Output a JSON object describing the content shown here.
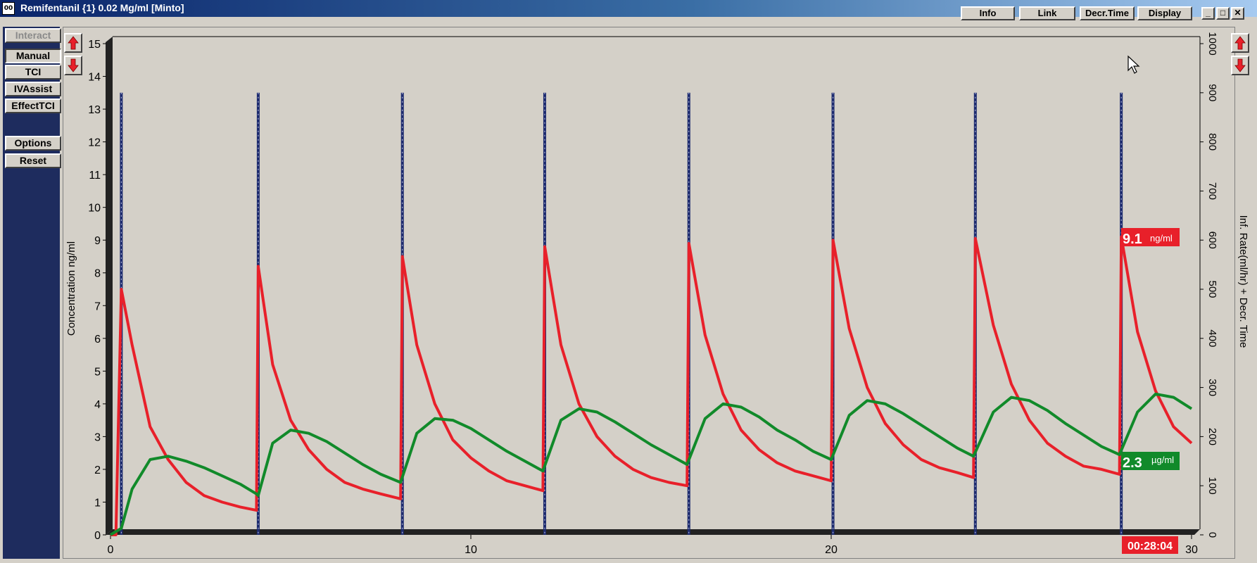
{
  "window": {
    "icon_text": "00",
    "title": "Remifentanil {1} 0.02 Mg/ml [Minto]",
    "buttons": [
      "Info",
      "Link",
      "Decr.Time",
      "Display"
    ],
    "controls": [
      "_",
      "□",
      "✕"
    ]
  },
  "sidebar": {
    "mode_buttons": [
      {
        "label": "Interact",
        "state": "disabled"
      },
      {
        "label": "Manual",
        "state": "pressed"
      },
      {
        "label": "TCI",
        "state": "normal"
      },
      {
        "label": "IVAssist",
        "state": "normal"
      },
      {
        "label": "EffectTCI",
        "state": "normal"
      }
    ],
    "action_buttons": [
      "Options",
      "Reset"
    ]
  },
  "readouts": {
    "plasma_value": "9.1",
    "plasma_unit": "ng/ml",
    "effect_value": "2.3",
    "effect_unit": "µg/ml",
    "elapsed_time": "00:28:04"
  },
  "colors": {
    "plasma": "#e8202a",
    "effect": "#118a2a",
    "bolus": "#1c2a6e",
    "plot_background": "#d4d0c8",
    "sidebar_background": "#1e2c5e"
  },
  "chart_data": {
    "type": "line",
    "xlim": [
      0,
      30
    ],
    "x_ticks": [
      0,
      10,
      20,
      30
    ],
    "ylim": [
      0,
      15
    ],
    "y_ticks": [
      0,
      1,
      2,
      3,
      4,
      5,
      6,
      7,
      8,
      9,
      10,
      11,
      12,
      13,
      14,
      15
    ],
    "ylabel": "Concentration ng/ml",
    "y2lim": [
      0,
      1000
    ],
    "y2_ticks": [
      0,
      100,
      200,
      300,
      400,
      500,
      600,
      700,
      800,
      900,
      1000
    ],
    "y2label": "Inf. Rate(ml/hr) + Decr. Time",
    "bolus_times": [
      0.3,
      4.1,
      8.1,
      12.05,
      16.05,
      20.05,
      24.0,
      28.05
    ],
    "bolus_rate": 900,
    "series": [
      {
        "key": "plasma",
        "points": [
          [
            0,
            0
          ],
          [
            0.15,
            0
          ],
          [
            0.3,
            7.5
          ],
          [
            0.6,
            5.8
          ],
          [
            1.1,
            3.3
          ],
          [
            1.6,
            2.3
          ],
          [
            2.1,
            1.6
          ],
          [
            2.6,
            1.2
          ],
          [
            3.1,
            1.0
          ],
          [
            3.6,
            0.85
          ],
          [
            4.05,
            0.75
          ],
          [
            4.1,
            8.2
          ],
          [
            4.5,
            5.2
          ],
          [
            5.0,
            3.5
          ],
          [
            5.5,
            2.6
          ],
          [
            6.0,
            2.0
          ],
          [
            6.5,
            1.6
          ],
          [
            7.0,
            1.4
          ],
          [
            7.5,
            1.25
          ],
          [
            8.05,
            1.1
          ],
          [
            8.1,
            8.5
          ],
          [
            8.5,
            5.8
          ],
          [
            9.0,
            4.0
          ],
          [
            9.5,
            2.9
          ],
          [
            10.0,
            2.35
          ],
          [
            10.5,
            1.95
          ],
          [
            11.0,
            1.65
          ],
          [
            11.5,
            1.5
          ],
          [
            12.0,
            1.35
          ],
          [
            12.05,
            8.8
          ],
          [
            12.5,
            5.8
          ],
          [
            13.0,
            4.0
          ],
          [
            13.5,
            3.0
          ],
          [
            14.0,
            2.4
          ],
          [
            14.5,
            2.0
          ],
          [
            15.0,
            1.75
          ],
          [
            15.5,
            1.6
          ],
          [
            16.0,
            1.5
          ],
          [
            16.05,
            8.9
          ],
          [
            16.5,
            6.1
          ],
          [
            17.0,
            4.3
          ],
          [
            17.5,
            3.2
          ],
          [
            18.0,
            2.6
          ],
          [
            18.5,
            2.2
          ],
          [
            19.0,
            1.95
          ],
          [
            19.5,
            1.8
          ],
          [
            20.0,
            1.65
          ],
          [
            20.05,
            9.0
          ],
          [
            20.5,
            6.3
          ],
          [
            21.0,
            4.5
          ],
          [
            21.5,
            3.4
          ],
          [
            22.0,
            2.75
          ],
          [
            22.5,
            2.3
          ],
          [
            23.0,
            2.05
          ],
          [
            23.5,
            1.9
          ],
          [
            23.95,
            1.75
          ],
          [
            24.0,
            9.05
          ],
          [
            24.5,
            6.4
          ],
          [
            25.0,
            4.6
          ],
          [
            25.5,
            3.5
          ],
          [
            26.0,
            2.8
          ],
          [
            26.5,
            2.4
          ],
          [
            27.0,
            2.1
          ],
          [
            27.5,
            2.0
          ],
          [
            28.0,
            1.85
          ],
          [
            28.05,
            9.1
          ],
          [
            28.5,
            6.2
          ],
          [
            29.0,
            4.4
          ],
          [
            29.5,
            3.3
          ],
          [
            30.0,
            2.8
          ]
        ]
      },
      {
        "key": "effect",
        "points": [
          [
            0,
            0
          ],
          [
            0.3,
            0.2
          ],
          [
            0.6,
            1.4
          ],
          [
            1.1,
            2.3
          ],
          [
            1.6,
            2.4
          ],
          [
            2.1,
            2.25
          ],
          [
            2.6,
            2.05
          ],
          [
            3.1,
            1.8
          ],
          [
            3.6,
            1.55
          ],
          [
            4.05,
            1.25
          ],
          [
            4.1,
            1.2
          ],
          [
            4.5,
            2.8
          ],
          [
            5.0,
            3.2
          ],
          [
            5.5,
            3.1
          ],
          [
            6.0,
            2.85
          ],
          [
            6.5,
            2.5
          ],
          [
            7.0,
            2.15
          ],
          [
            7.5,
            1.85
          ],
          [
            8.05,
            1.6
          ],
          [
            8.5,
            3.1
          ],
          [
            9.0,
            3.55
          ],
          [
            9.5,
            3.5
          ],
          [
            10.0,
            3.25
          ],
          [
            10.5,
            2.9
          ],
          [
            11.0,
            2.55
          ],
          [
            11.5,
            2.25
          ],
          [
            12.0,
            1.95
          ],
          [
            12.5,
            3.5
          ],
          [
            13.0,
            3.85
          ],
          [
            13.5,
            3.75
          ],
          [
            14.0,
            3.45
          ],
          [
            14.5,
            3.1
          ],
          [
            15.0,
            2.75
          ],
          [
            15.5,
            2.45
          ],
          [
            16.0,
            2.15
          ],
          [
            16.5,
            3.55
          ],
          [
            17.0,
            4.0
          ],
          [
            17.5,
            3.9
          ],
          [
            18.0,
            3.6
          ],
          [
            18.5,
            3.2
          ],
          [
            19.0,
            2.9
          ],
          [
            19.5,
            2.55
          ],
          [
            20.0,
            2.3
          ],
          [
            20.5,
            3.65
          ],
          [
            21.0,
            4.1
          ],
          [
            21.5,
            4.0
          ],
          [
            22.0,
            3.7
          ],
          [
            22.5,
            3.35
          ],
          [
            23.0,
            3.0
          ],
          [
            23.5,
            2.65
          ],
          [
            23.95,
            2.4
          ],
          [
            24.5,
            3.75
          ],
          [
            25.0,
            4.2
          ],
          [
            25.5,
            4.1
          ],
          [
            26.0,
            3.8
          ],
          [
            26.5,
            3.4
          ],
          [
            27.0,
            3.05
          ],
          [
            27.5,
            2.7
          ],
          [
            28.0,
            2.45
          ],
          [
            28.5,
            3.75
          ],
          [
            29.0,
            4.3
          ],
          [
            29.5,
            4.2
          ],
          [
            30.0,
            3.85
          ]
        ]
      }
    ]
  }
}
